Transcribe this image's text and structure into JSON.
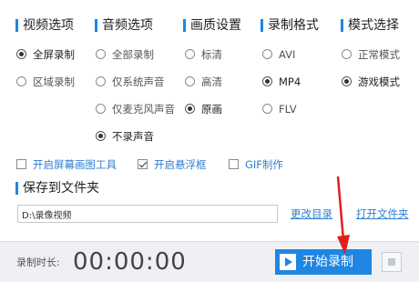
{
  "sections": {
    "video": {
      "title": "视频选项",
      "options": [
        {
          "label": "全屏录制",
          "checked": true
        },
        {
          "label": "区域录制",
          "checked": false
        }
      ]
    },
    "audio": {
      "title": "音频选项",
      "options": [
        {
          "label": "全部录制",
          "checked": false
        },
        {
          "label": "仅系统声音",
          "checked": false
        },
        {
          "label": "仅麦克风声音",
          "checked": false
        },
        {
          "label": "不录声音",
          "checked": true
        }
      ]
    },
    "quality": {
      "title": "画质设置",
      "options": [
        {
          "label": "标清",
          "checked": false
        },
        {
          "label": "高清",
          "checked": false
        },
        {
          "label": "原画",
          "checked": true
        }
      ]
    },
    "format": {
      "title": "录制格式",
      "options": [
        {
          "label": "AVI",
          "checked": false
        },
        {
          "label": "MP4",
          "checked": true
        },
        {
          "label": "FLV",
          "checked": false
        }
      ]
    },
    "mode": {
      "title": "模式选择",
      "options": [
        {
          "label": "正常模式",
          "checked": false
        },
        {
          "label": "游戏模式",
          "checked": true
        }
      ]
    }
  },
  "checkboxes": [
    {
      "label": "开启屏幕画图工具",
      "checked": false
    },
    {
      "label": "开启悬浮框",
      "checked": true
    },
    {
      "label": "GIF制作",
      "checked": false
    }
  ],
  "save": {
    "title": "保存到文件夹",
    "path_value": "D:\\录像视频",
    "change_dir_label": "更改目录",
    "open_folder_label": "打开文件夹"
  },
  "bottom": {
    "duration_label": "录制时长:",
    "duration_value": "00:00:00",
    "start_label": "开始录制"
  },
  "colors": {
    "accent": "#1f86e3",
    "link": "#2f7fd1",
    "arrow": "#e0201e",
    "bottom_bar": "#eef0f3"
  },
  "icons": {
    "play": "play-icon",
    "stop": "stop-icon",
    "arrow": "red-arrow-annotation"
  }
}
